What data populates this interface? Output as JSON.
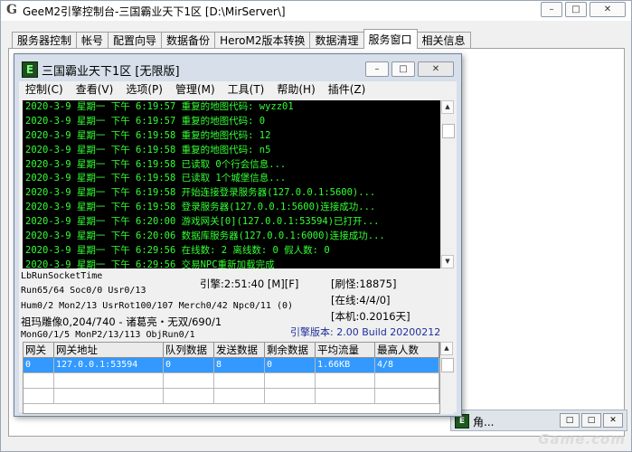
{
  "app": {
    "title": "GeeM2引擎控制台-三国霸业天下1区 [D:\\MirServer\\]",
    "icon_glyph": "G"
  },
  "caption_buttons": {
    "minimize": "–",
    "maximize": "□",
    "close": "✕"
  },
  "tabs": [
    {
      "label": "服务器控制",
      "active": false
    },
    {
      "label": "帐号",
      "active": false
    },
    {
      "label": "配置向导",
      "active": false
    },
    {
      "label": "数据备份",
      "active": false
    },
    {
      "label": "HeroM2版本转换",
      "active": false
    },
    {
      "label": "数据清理",
      "active": false
    },
    {
      "label": "服务窗口",
      "active": true
    },
    {
      "label": "相关信息",
      "active": false
    }
  ],
  "child_window": {
    "title": "三国霸业天下1区 [无限版]",
    "icon_glyph": "E",
    "menu": [
      "控制(C)",
      "查看(V)",
      "选项(P)",
      "管理(M)",
      "工具(T)",
      "帮助(H)",
      "插件(Z)"
    ],
    "log_lines": [
      "2020-3-9 星期一 下午 6:19:57 重复的地图代码: wyzz01",
      "2020-3-9 星期一 下午 6:19:57 重复的地图代码: 0",
      "2020-3-9 星期一 下午 6:19:58 重复的地图代码: 12",
      "2020-3-9 星期一 下午 6:19:58 重复的地图代码: n5",
      "2020-3-9 星期一 下午 6:19:58 已读取 0个行会信息...",
      "2020-3-9 星期一 下午 6:19:58 已读取 1个城堡信息...",
      "2020-3-9 星期一 下午 6:19:58 开始连接登录服务器(127.0.0.1:5600)...",
      "2020-3-9 星期一 下午 6:19:58 登录服务器(127.0.0.1:5600)连接成功...",
      "2020-3-9 星期一 下午 6:20:00 游戏网关[0](127.0.0.1:53594)已打开...",
      "2020-3-9 星期一 下午 6:20:06 数据库服务器(127.0.0.1:6000)连接成功...",
      "2020-3-9 星期一 下午 6:29:56 在线数: 2 离线数: 0 假人数: 0",
      "2020-3-9 星期一 下午 6:29:56 交易NPC重新加载完成"
    ],
    "status": {
      "lb_run_socket": "LbRunSocketTime",
      "run_line": "Run65/64 Soc0/0 Usr0/13",
      "engine_time": "引擎:2:51:40 [M][F]",
      "refresh": "[刷怪:18875]",
      "online": "[在线:4/4/0]",
      "version_local": "[本机:0.2016天]",
      "hum_line": "Hum0/2 Mon2/13 UsrRot100/107 Merch0/42 Npc0/11 (0)",
      "statue_line": "祖玛雕像0,204/740 - 诸葛亮・无双/690/1",
      "engine_version": "引擎版本: 2.00 Build 20200212",
      "mon_line": "MonG0/1/5 MonP2/13/113 ObjRun0/1"
    },
    "grid": {
      "columns": [
        "网关",
        "网关地址",
        "队列数据",
        "发送数据",
        "剩余数据",
        "平均流量",
        "最高人数"
      ],
      "rows": [
        [
          "0",
          "127.0.0.1:53594",
          "0",
          "8",
          "0",
          "1.66KB",
          "4/8"
        ]
      ]
    }
  },
  "minimized_window": {
    "label": "角...",
    "icon_glyph": "E"
  },
  "watermark": "Game.com"
}
